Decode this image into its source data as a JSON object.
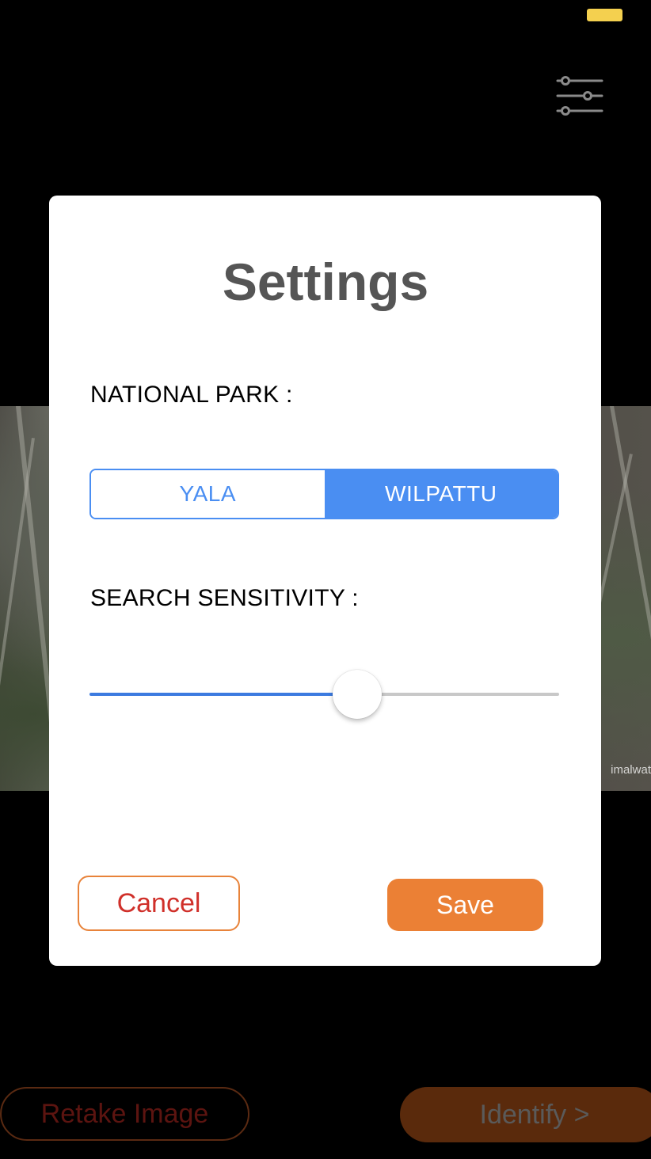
{
  "status_bar": {
    "battery_color": "#f4d04f"
  },
  "header": {
    "filter_icon": "sliders-icon"
  },
  "background_photo": {
    "watermark": "imalwat"
  },
  "bottom_bar": {
    "retake_label": "Retake Image",
    "identify_label": "Identify >"
  },
  "settings_modal": {
    "title": "Settings",
    "national_park": {
      "label": "NATIONAL PARK :",
      "options": [
        "YALA",
        "WILPATTU"
      ],
      "selected": "WILPATTU"
    },
    "search_sensitivity": {
      "label": "SEARCH SENSITIVITY :",
      "value": 0.57
    },
    "cancel_label": "Cancel",
    "save_label": "Save"
  },
  "colors": {
    "accent_blue": "#4a8ef2",
    "accent_orange": "#eb8035",
    "cancel_red": "#d0302a"
  }
}
